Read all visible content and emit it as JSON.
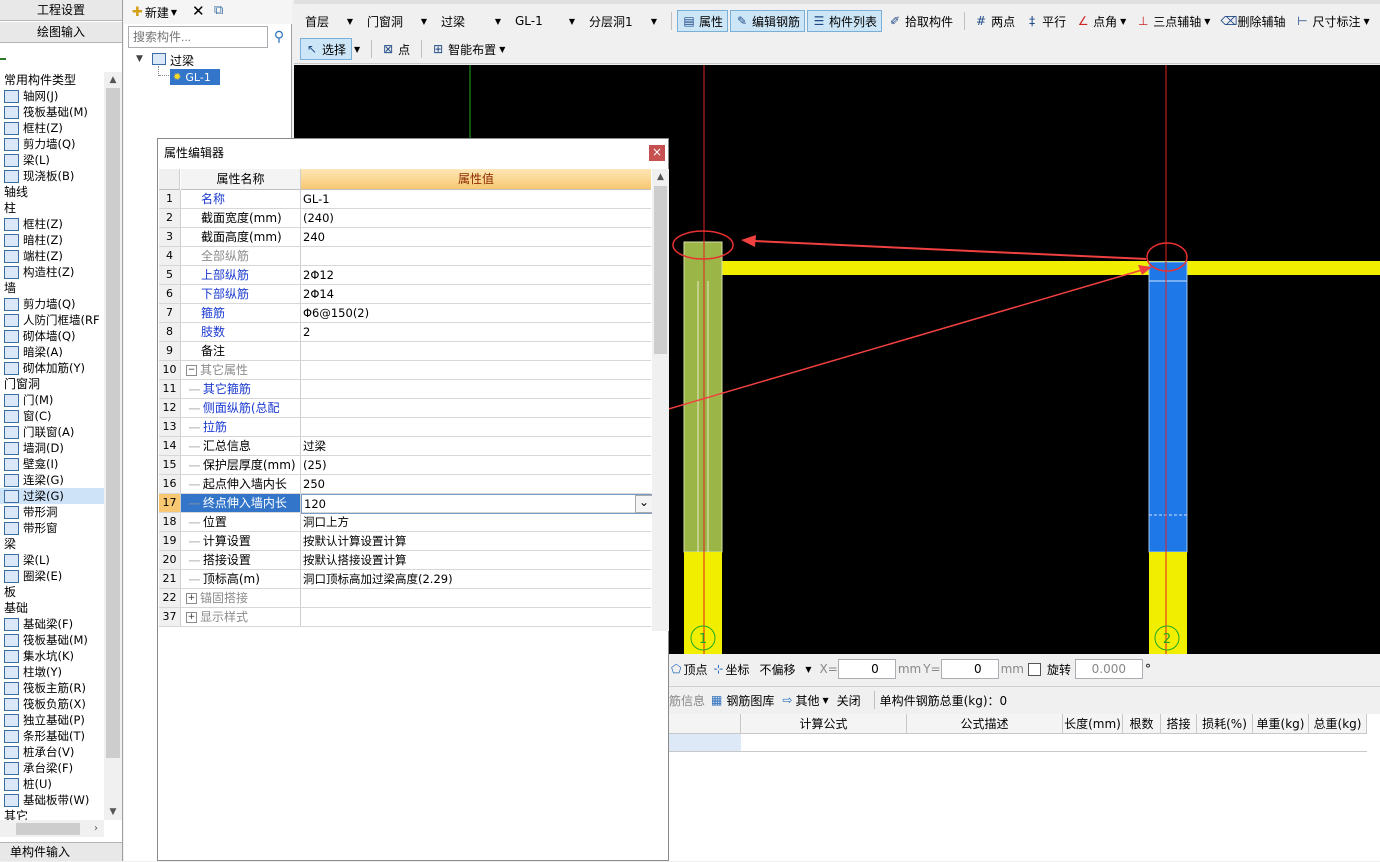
{
  "left_panel": {
    "tab1": "工程设置",
    "tab2": "绘图输入",
    "bottom_tab": "单构件输入",
    "items": [
      {
        "label": "常用构件类型",
        "kind": "cat"
      },
      {
        "label": "轴网(J)",
        "kind": "it"
      },
      {
        "label": "筏板基础(M)",
        "kind": "it"
      },
      {
        "label": "框柱(Z)",
        "kind": "it"
      },
      {
        "label": "剪力墙(Q)",
        "kind": "it"
      },
      {
        "label": "梁(L)",
        "kind": "it"
      },
      {
        "label": "现浇板(B)",
        "kind": "it"
      },
      {
        "label": "轴线",
        "kind": "cat"
      },
      {
        "label": "柱",
        "kind": "cat"
      },
      {
        "label": "框柱(Z)",
        "kind": "it"
      },
      {
        "label": "暗柱(Z)",
        "kind": "it"
      },
      {
        "label": "端柱(Z)",
        "kind": "it"
      },
      {
        "label": "构造柱(Z)",
        "kind": "it"
      },
      {
        "label": "墙",
        "kind": "cat"
      },
      {
        "label": "剪力墙(Q)",
        "kind": "it"
      },
      {
        "label": "人防门框墙(RF",
        "kind": "it"
      },
      {
        "label": "砌体墙(Q)",
        "kind": "it"
      },
      {
        "label": "暗梁(A)",
        "kind": "it"
      },
      {
        "label": "砌体加筋(Y)",
        "kind": "it"
      },
      {
        "label": "门窗洞",
        "kind": "cat"
      },
      {
        "label": "门(M)",
        "kind": "it"
      },
      {
        "label": "窗(C)",
        "kind": "it"
      },
      {
        "label": "门联窗(A)",
        "kind": "it"
      },
      {
        "label": "墙洞(D)",
        "kind": "it"
      },
      {
        "label": "壁龛(I)",
        "kind": "it"
      },
      {
        "label": "连梁(G)",
        "kind": "it"
      },
      {
        "label": "过梁(G)",
        "kind": "it",
        "selected": true
      },
      {
        "label": "带形洞",
        "kind": "it"
      },
      {
        "label": "带形窗",
        "kind": "it"
      },
      {
        "label": "梁",
        "kind": "cat"
      },
      {
        "label": "梁(L)",
        "kind": "it"
      },
      {
        "label": "圈梁(E)",
        "kind": "it"
      },
      {
        "label": "板",
        "kind": "cat"
      },
      {
        "label": "基础",
        "kind": "cat"
      },
      {
        "label": "基础梁(F)",
        "kind": "it"
      },
      {
        "label": "筏板基础(M)",
        "kind": "it"
      },
      {
        "label": "集水坑(K)",
        "kind": "it"
      },
      {
        "label": "柱墩(Y)",
        "kind": "it"
      },
      {
        "label": "筏板主筋(R)",
        "kind": "it"
      },
      {
        "label": "筏板负筋(X)",
        "kind": "it"
      },
      {
        "label": "独立基础(P)",
        "kind": "it"
      },
      {
        "label": "条形基础(T)",
        "kind": "it"
      },
      {
        "label": "桩承台(V)",
        "kind": "it"
      },
      {
        "label": "承台梁(F)",
        "kind": "it"
      },
      {
        "label": "桩(U)",
        "kind": "it"
      },
      {
        "label": "基础板带(W)",
        "kind": "it"
      },
      {
        "label": "其它",
        "kind": "cat"
      }
    ]
  },
  "mid_panel": {
    "new_label": "新建",
    "search_placeholder": "搜索构件...",
    "tree_root": "过梁",
    "tree_child": "GL-1"
  },
  "toolbar": {
    "floor": "首层",
    "category": "门窗洞",
    "type": "过梁",
    "component": "GL-1",
    "layer": "分层洞1",
    "btn_props": "属性",
    "btn_edit_rebar": "编辑钢筋",
    "btn_component_list": "构件列表",
    "btn_pick": "拾取构件",
    "btn_two_points": "两点",
    "btn_parallel": "平行",
    "btn_point_angle": "点角",
    "btn_three_point": "三点辅轴",
    "btn_delete_aux": "删除辅轴",
    "btn_dimension": "尺寸标注",
    "btn_select": "选择",
    "btn_point": "点",
    "btn_smart": "智能布置"
  },
  "canvas": {
    "axis1": "1",
    "axis2": "2",
    "colors": {
      "bg": "#000000",
      "beam": "#f2ee00",
      "wall_green": "#9bb546",
      "wall_blue": "#1f78e8",
      "axis_line": "#e02020",
      "arrow": "#f04040"
    }
  },
  "statusbar": {
    "vertex": "顶点",
    "coord": "坐标",
    "offset": "不偏移",
    "x_label": "X=",
    "x_value": "0",
    "mm1": "mm",
    "y_label": "Y=",
    "y_value": "0",
    "mm2": "mm",
    "rotate": "旋转",
    "rotate_value": "0.000",
    "degree": "°"
  },
  "rebar_toolbar": {
    "info": "筋信息",
    "library": "钢筋图库",
    "other": "其他",
    "close": "关闭",
    "total_weight": "单构件钢筋总重(kg)：0"
  },
  "rebar_grid": {
    "headers": [
      "计算公式",
      "公式描述",
      "长度(mm)",
      "根数",
      "搭接",
      "损耗(%)",
      "单重(kg)",
      "总重(kg)"
    ]
  },
  "dialog": {
    "title": "属性编辑器",
    "col_name": "属性名称",
    "col_value": "属性值",
    "rows": [
      {
        "num": "1",
        "name": "名称",
        "value": "GL-1",
        "style": "blue",
        "indent": 0
      },
      {
        "num": "2",
        "name": "截面宽度(mm)",
        "value": "(240)",
        "style": "",
        "indent": 0
      },
      {
        "num": "3",
        "name": "截面高度(mm)",
        "value": "240",
        "style": "",
        "indent": 0
      },
      {
        "num": "4",
        "name": "全部纵筋",
        "value": "",
        "style": "gray",
        "indent": 0
      },
      {
        "num": "5",
        "name": "上部纵筋",
        "value": "2Φ12",
        "style": "blue",
        "indent": 0
      },
      {
        "num": "6",
        "name": "下部纵筋",
        "value": "2Φ14",
        "style": "blue",
        "indent": 0
      },
      {
        "num": "7",
        "name": "箍筋",
        "value": "Φ6@150(2)",
        "style": "blue",
        "indent": 0
      },
      {
        "num": "8",
        "name": "肢数",
        "value": "2",
        "style": "blue",
        "indent": 0
      },
      {
        "num": "9",
        "name": "备注",
        "value": "",
        "style": "",
        "indent": 0
      },
      {
        "num": "10",
        "name": "其它属性",
        "value": "",
        "style": "gray",
        "indent": 0,
        "expander": "−"
      },
      {
        "num": "11",
        "name": "其它箍筋",
        "value": "",
        "style": "blue",
        "indent": 1
      },
      {
        "num": "12",
        "name": "侧面纵筋(总配",
        "value": "",
        "style": "blue",
        "indent": 1
      },
      {
        "num": "13",
        "name": "拉筋",
        "value": "",
        "style": "blue",
        "indent": 1
      },
      {
        "num": "14",
        "name": "汇总信息",
        "value": "过梁",
        "style": "",
        "indent": 1
      },
      {
        "num": "15",
        "name": "保护层厚度(mm)",
        "value": "(25)",
        "style": "",
        "indent": 1
      },
      {
        "num": "16",
        "name": "起点伸入墙内长",
        "value": "250",
        "style": "",
        "indent": 1
      },
      {
        "num": "17",
        "name": "终点伸入墙内长",
        "value": "120",
        "style": "selected",
        "indent": 1
      },
      {
        "num": "18",
        "name": "位置",
        "value": "洞口上方",
        "style": "",
        "indent": 1
      },
      {
        "num": "19",
        "name": "计算设置",
        "value": "按默认计算设置计算",
        "style": "",
        "indent": 1
      },
      {
        "num": "20",
        "name": "搭接设置",
        "value": "按默认搭接设置计算",
        "style": "",
        "indent": 1
      },
      {
        "num": "21",
        "name": "顶标高(m)",
        "value": "洞口顶标高加过梁高度(2.29)",
        "style": "",
        "indent": 1
      },
      {
        "num": "22",
        "name": "锚固搭接",
        "value": "",
        "style": "gray",
        "indent": 0,
        "expander": "+"
      },
      {
        "num": "37",
        "name": "显示样式",
        "value": "",
        "style": "gray",
        "indent": 0,
        "expander": "+"
      }
    ]
  }
}
